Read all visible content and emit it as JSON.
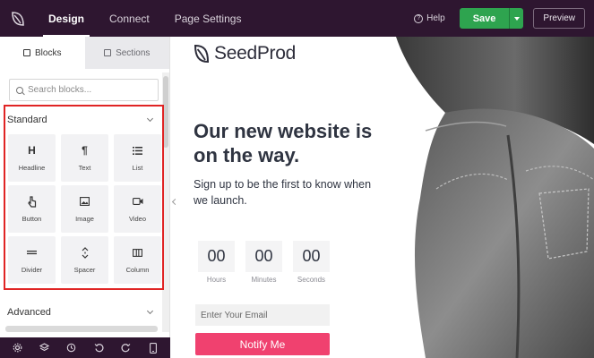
{
  "topbar": {
    "tabs": [
      {
        "label": "Design",
        "active": true
      },
      {
        "label": "Connect",
        "active": false
      },
      {
        "label": "Page Settings",
        "active": false
      }
    ],
    "help_label": "Help",
    "save_label": "Save",
    "preview_label": "Preview"
  },
  "sidebar": {
    "tabs": [
      {
        "label": "Blocks",
        "active": true
      },
      {
        "label": "Sections",
        "active": false
      }
    ],
    "search_placeholder": "Search blocks...",
    "standard_label": "Standard",
    "advanced_label": "Advanced",
    "blocks": [
      {
        "label": "Headline",
        "icon": "heading-icon"
      },
      {
        "label": "Text",
        "icon": "paragraph-icon"
      },
      {
        "label": "List",
        "icon": "list-icon"
      },
      {
        "label": "Button",
        "icon": "pointer-icon"
      },
      {
        "label": "Image",
        "icon": "image-icon"
      },
      {
        "label": "Video",
        "icon": "video-icon"
      },
      {
        "label": "Divider",
        "icon": "divider-icon"
      },
      {
        "label": "Spacer",
        "icon": "spacer-icon"
      },
      {
        "label": "Column",
        "icon": "columns-icon"
      }
    ]
  },
  "canvas": {
    "brand": "SeedProd",
    "headline": "Our new website is on the way.",
    "subtext": "Sign up to be the first to know when we launch.",
    "countdown": [
      {
        "value": "00",
        "label": "Hours"
      },
      {
        "value": "00",
        "label": "Minutes"
      },
      {
        "value": "00",
        "label": "Seconds"
      }
    ],
    "email_placeholder": "Enter Your Email",
    "notify_label": "Notify Me"
  },
  "colors": {
    "topbar_bg": "#2e1630",
    "save_green": "#2ea44f",
    "notify_pink": "#f0416f",
    "highlight_red": "#e02424"
  }
}
